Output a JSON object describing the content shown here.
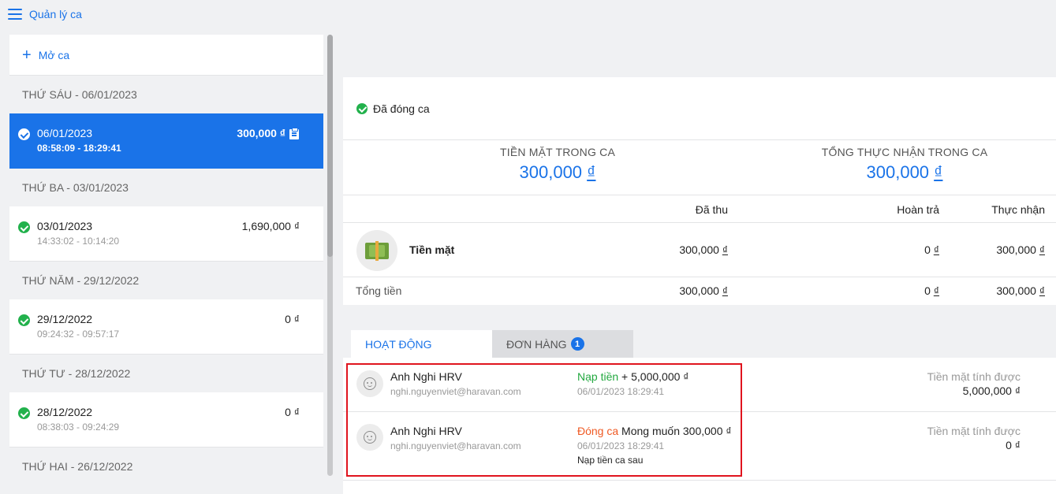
{
  "header": {
    "title": "Quản lý ca"
  },
  "sidebar": {
    "open_shift_label": "Mở ca",
    "groups": [
      {
        "day": "THỨ SÁU - 06/01/2023",
        "date": "06/01/2023",
        "time": "08:58:09 - 18:29:41",
        "amount": "300,000 ₫",
        "active": true
      },
      {
        "day": "THỨ BA - 03/01/2023",
        "date": "03/01/2023",
        "time": "14:33:02 - 10:14:20",
        "amount": "1,690,000 ₫"
      },
      {
        "day": "THỨ NĂM - 29/12/2022",
        "date": "29/12/2022",
        "time": "09:24:32 - 09:57:17",
        "amount": "0 ₫"
      },
      {
        "day": "THỨ TƯ - 28/12/2022",
        "date": "28/12/2022",
        "time": "08:38:03 - 09:24:29",
        "amount": "0 ₫"
      },
      {
        "day": "THỨ HAI - 26/12/2022"
      }
    ]
  },
  "main": {
    "status": "Đã đóng ca",
    "summary": {
      "cash_label": "TIỀN MẶT TRONG CA",
      "cash_value": "300,000",
      "net_label": "TỔNG THỰC NHẬN TRONG CA",
      "net_value": "300,000",
      "currency": "₫"
    },
    "payment_table": {
      "headers": [
        "Đã thu",
        "Hoàn trả",
        "Thực nhận"
      ],
      "rows": [
        {
          "name": "Tiền mặt",
          "collected": "300,000",
          "refund": "0",
          "net": "300,000"
        }
      ],
      "total": {
        "label": "Tổng tiền",
        "collected": "300,000",
        "refund": "0",
        "net": "300,000"
      },
      "currency": "₫"
    },
    "tabs": [
      {
        "label": "HOẠT ĐỘNG",
        "active": true
      },
      {
        "label": "ĐƠN HÀNG",
        "badge": "1"
      }
    ],
    "activities": [
      {
        "user": "Anh Nghi HRV",
        "email": "nghi.nguyenviet@haravan.com",
        "action": "Nạp tiền",
        "detail": "+ 5,000,000 ₫",
        "time": "06/01/2023 18:29:41",
        "calc_label": "Tiền mặt tính được",
        "calc_value": "5,000,000 ₫"
      },
      {
        "user": "Anh Nghi HRV",
        "email": "nghi.nguyenviet@haravan.com",
        "action": "Đóng ca",
        "detail": "Mong muốn 300,000 ₫",
        "time": "06/01/2023 18:29:41",
        "note": "Nạp tiền ca sau",
        "calc_label": "Tiền mặt tính được",
        "calc_value": "0 ₫"
      }
    ]
  },
  "colors": {
    "accent": "#1a73e8",
    "success": "#22b14c",
    "danger": "#ef5a24",
    "highlight": "#e0141e"
  }
}
